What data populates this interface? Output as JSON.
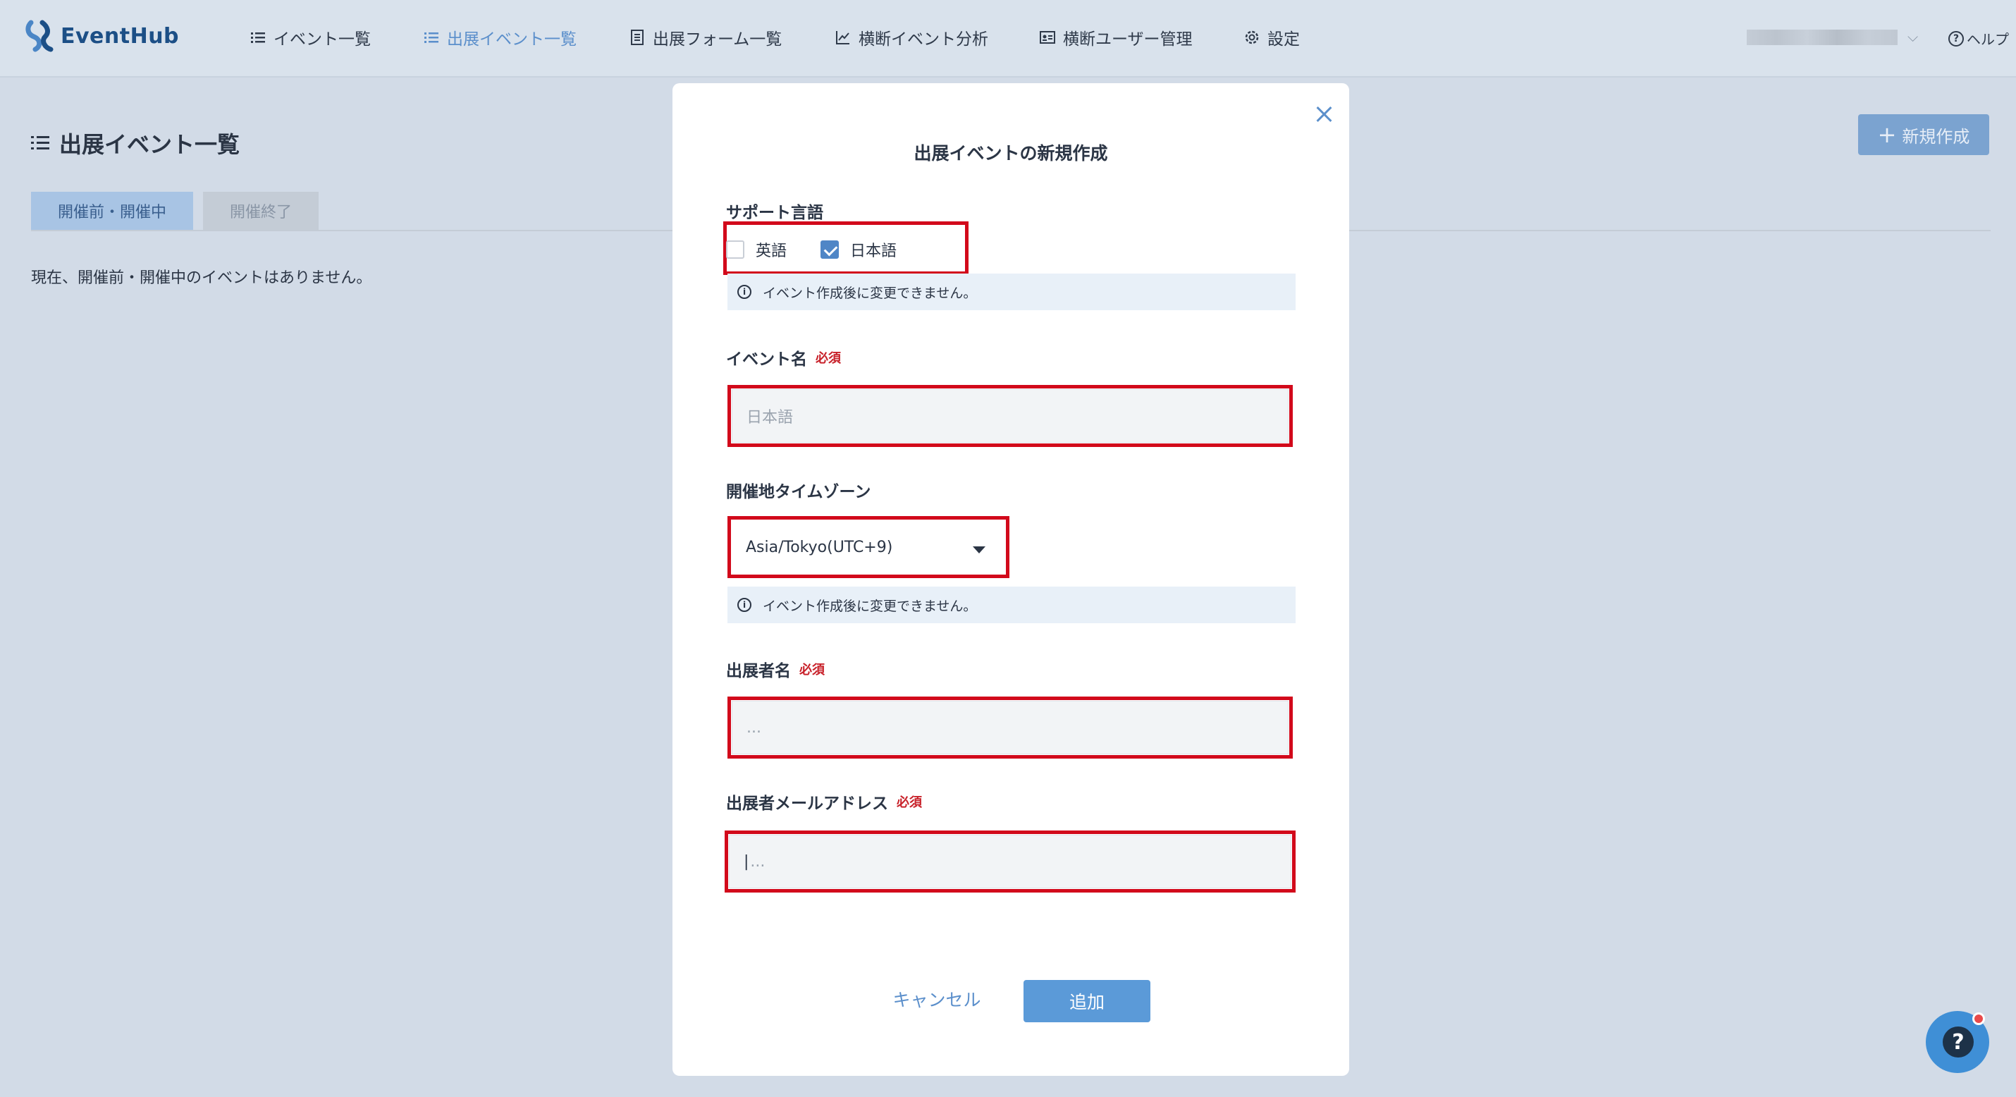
{
  "app": {
    "name": "EventHub"
  },
  "nav": {
    "items": [
      {
        "label": "イベント一覧",
        "icon": "list-icon"
      },
      {
        "label": "出展イベント一覧",
        "icon": "list-icon"
      },
      {
        "label": "出展フォーム一覧",
        "icon": "form-icon"
      },
      {
        "label": "横断イベント分析",
        "icon": "chart-icon"
      },
      {
        "label": "横断ユーザー管理",
        "icon": "id-card-icon"
      },
      {
        "label": "設定",
        "icon": "gear-icon"
      }
    ],
    "help_label": "ヘルプ"
  },
  "page": {
    "title": "出展イベント一覧",
    "new_button_label": "新規作成",
    "tabs": [
      {
        "label": "開催前・開催中"
      },
      {
        "label": "開催終了"
      }
    ],
    "empty_message": "現在、開催前・開催中のイベントはありません。"
  },
  "modal": {
    "title": "出展イベントの新規作成",
    "support_language": {
      "label": "サポート言語",
      "options": [
        {
          "label": "英語",
          "checked": false
        },
        {
          "label": "日本語",
          "checked": true
        }
      ],
      "note": "イベント作成後に変更できません。"
    },
    "event_name": {
      "label": "イベント名",
      "required_label": "必須",
      "placeholder": "日本語"
    },
    "timezone": {
      "label": "開催地タイムゾーン",
      "value": "Asia/Tokyo(UTC+9)",
      "note": "イベント作成後に変更できません。"
    },
    "exhibitor_name": {
      "label": "出展者名",
      "required_label": "必須",
      "placeholder": "..."
    },
    "exhibitor_email": {
      "label": "出展者メールアドレス",
      "required_label": "必須",
      "placeholder": "..."
    },
    "cancel_label": "キャンセル",
    "add_label": "追加"
  },
  "colors": {
    "accent": "#5b8fcb",
    "highlight": "#d2091b",
    "required": "#c8212a"
  }
}
